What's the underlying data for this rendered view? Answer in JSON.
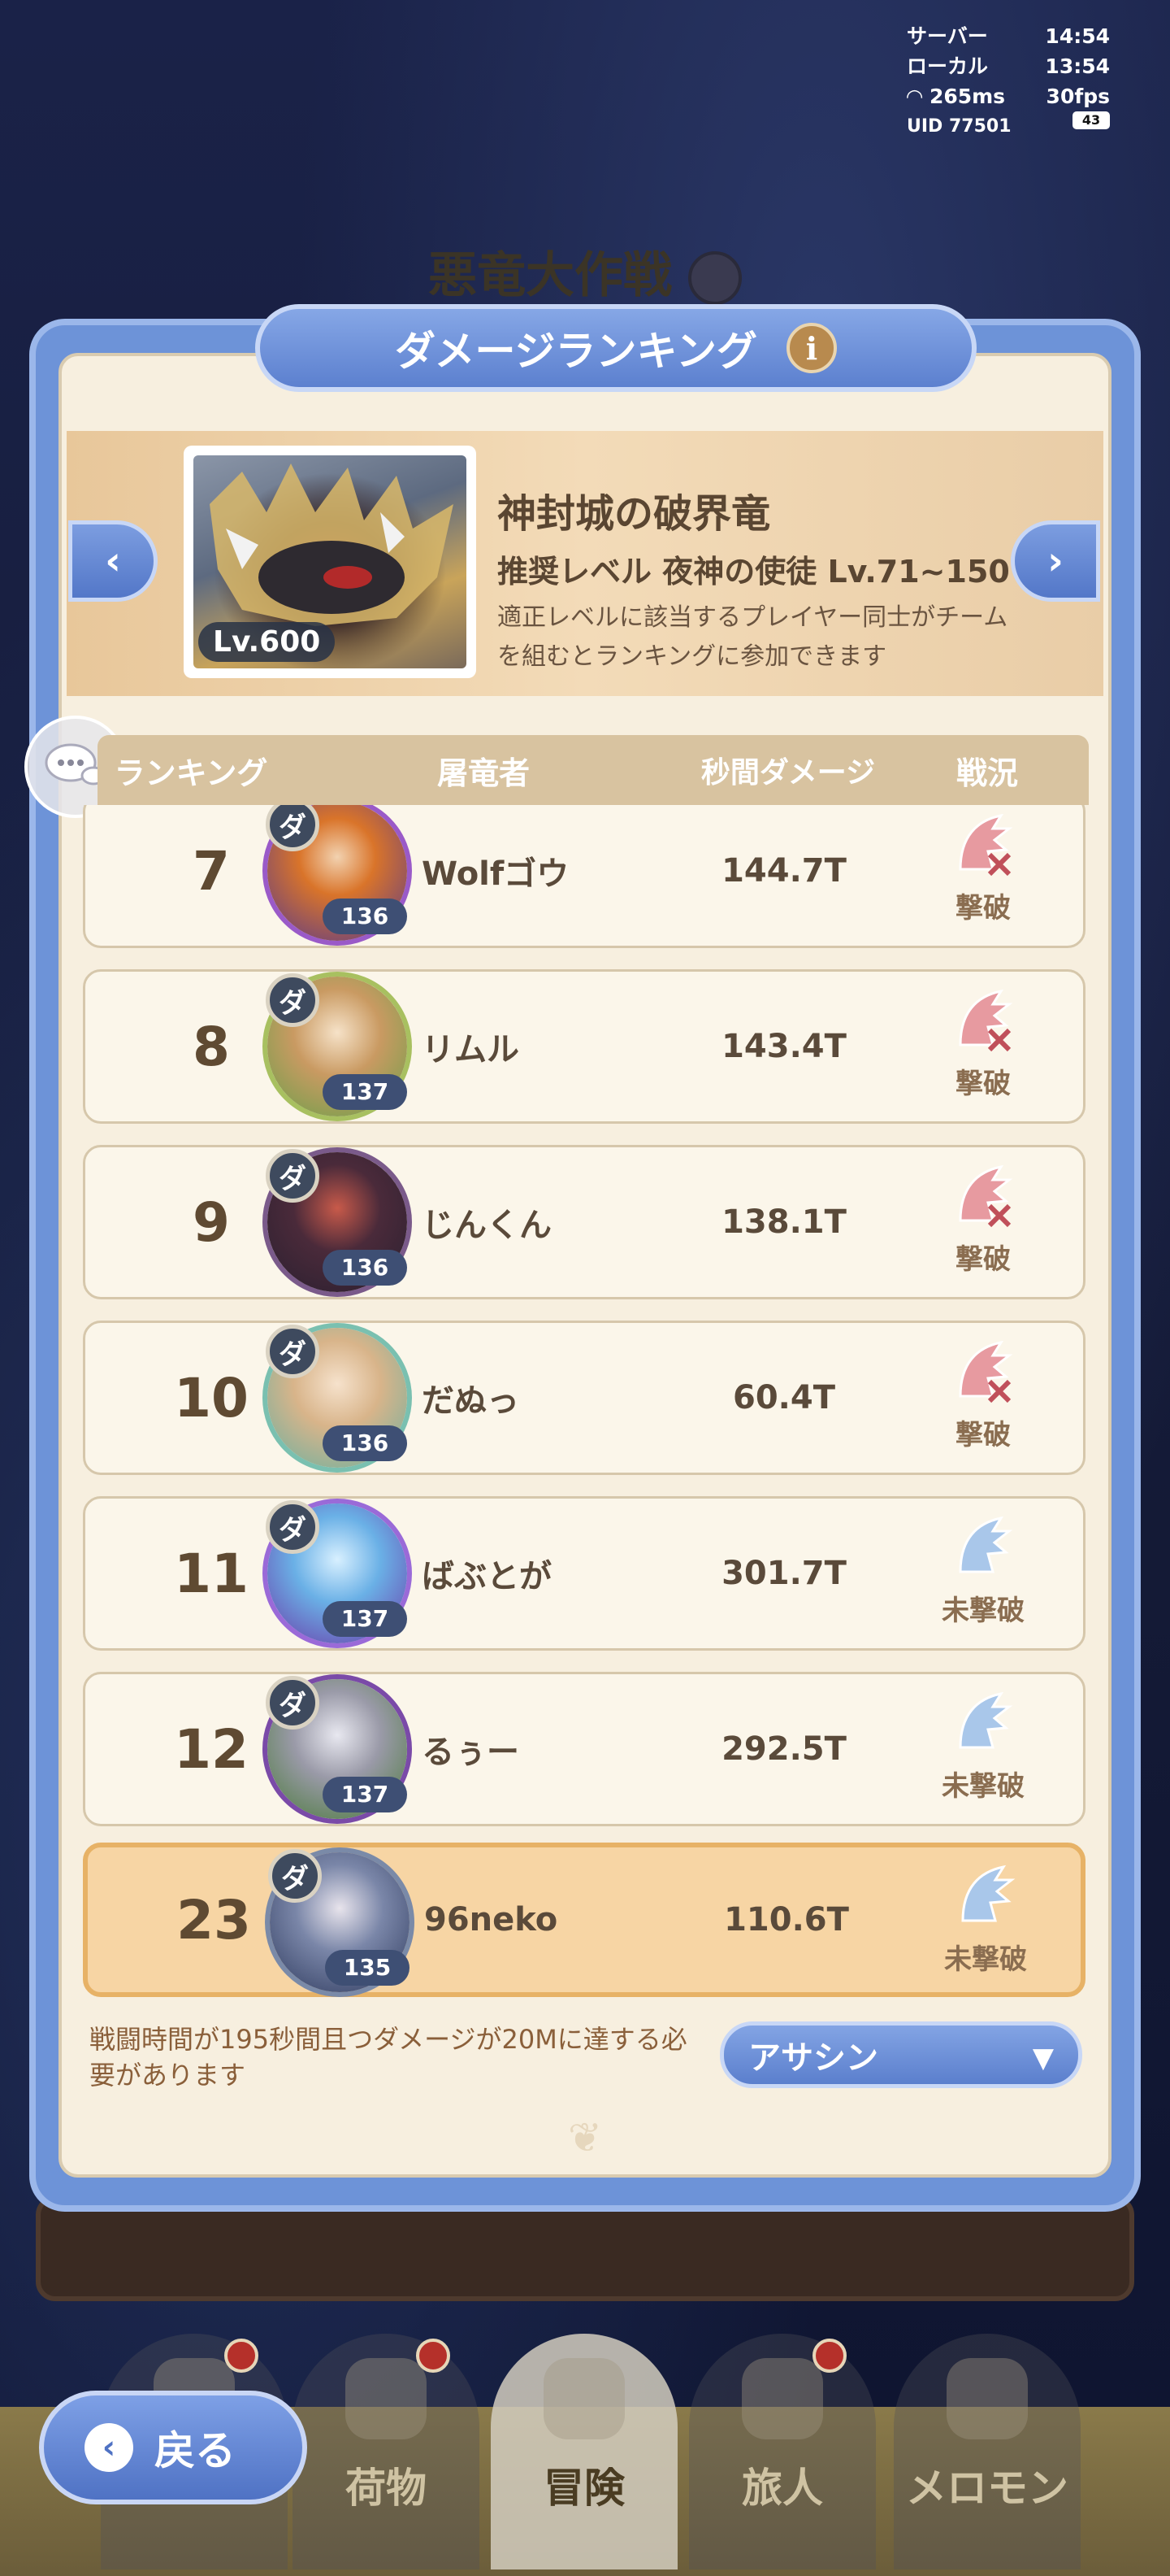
{
  "background": {
    "event_title": "悪竜大作戦"
  },
  "hud": {
    "server_label": "サーバー",
    "server_time": "14:54",
    "local_label": "ローカル",
    "local_time": "13:54",
    "ping": "265ms",
    "fps": "30fps",
    "uid": "UID 77501",
    "battery": "43"
  },
  "modal": {
    "title": "ダメージランキング",
    "info_icon": "i"
  },
  "boss": {
    "level_badge": "Lv.600",
    "name": "神封城の破界竜",
    "recommended": "推奨レベル 夜神の使徒 Lv.71~150",
    "note": "適正レベルに該当するプレイヤー同士がチームを組むとランキングに参加できます"
  },
  "table": {
    "headers": {
      "rank": "ランキング",
      "player": "屠竜者",
      "dps": "秒間ダメージ",
      "status": "戦況"
    },
    "rows": [
      {
        "rank": "7",
        "name": "Wolfゴウ",
        "level": "136",
        "dps": "144.7T",
        "status": "撃破",
        "defeated": true
      },
      {
        "rank": "8",
        "name": "リムル",
        "level": "137",
        "dps": "143.4T",
        "status": "撃破",
        "defeated": true
      },
      {
        "rank": "9",
        "name": "じんくん",
        "level": "136",
        "dps": "138.1T",
        "status": "撃破",
        "defeated": true
      },
      {
        "rank": "10",
        "name": "だぬっ",
        "level": "136",
        "dps": "60.4T",
        "status": "撃破",
        "defeated": true
      },
      {
        "rank": "11",
        "name": "ばぶとが",
        "level": "137",
        "dps": "301.7T",
        "status": "未撃破",
        "defeated": false
      },
      {
        "rank": "12",
        "name": "るぅー",
        "level": "137",
        "dps": "292.5T",
        "status": "未撃破",
        "defeated": false
      }
    ],
    "me": {
      "rank": "23",
      "name": "96neko",
      "level": "135",
      "dps": "110.6T",
      "status": "未撃破",
      "defeated": false
    }
  },
  "footer": {
    "requirement": "戦闘時間が195秒間且つダメージが20Mに達する必要があります",
    "class_select": "アサシン"
  },
  "nav": {
    "back": "戻る",
    "items": [
      "荷物",
      "冒険",
      "旅人",
      "メロモン"
    ],
    "active": "冒険"
  },
  "colors": {
    "accent_blue": "#5c80cf",
    "panel_cream": "#f7efdf",
    "me_highlight": "#f7d5a4",
    "defeated_icon": "#e79aa0",
    "undefeated_icon": "#a9c7ea"
  }
}
